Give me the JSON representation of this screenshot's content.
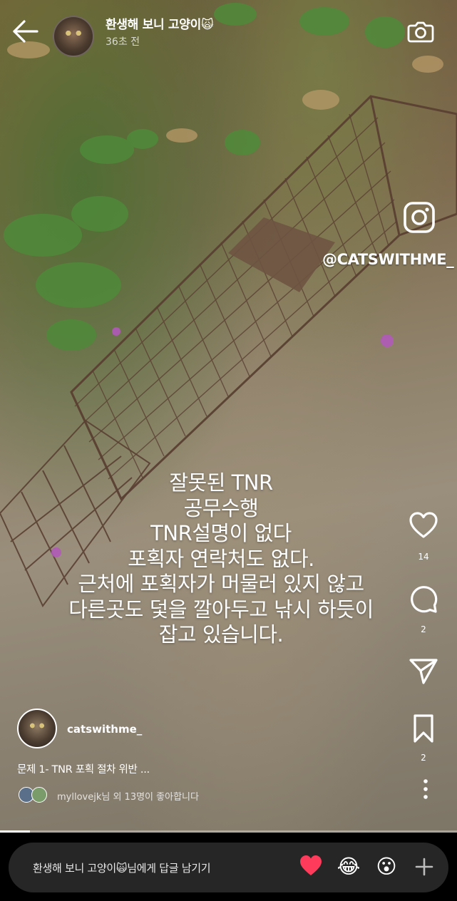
{
  "story": {
    "username": "환생해 보니 고양이🙀",
    "time": "36초 전"
  },
  "media": {
    "sticker_handle": "@CATSWITHME_",
    "overlay_lines": [
      "잘못된 TNR",
      "공무수행",
      "TNR설명이 없다",
      "포획자 연락처도 없다.",
      "근처에 포획자가 머물러 있지 않고",
      "다른곳도 덫을 깔아두고 낚시 하듯이",
      "잡고 있습니다."
    ]
  },
  "actions": {
    "like_count": "14",
    "comment_count": "2",
    "save_count": "2"
  },
  "post": {
    "author": "catswithme_",
    "caption": "문제 1- TNR 포획 절차 위반 ...",
    "likes_text": "myllovejk님 외 13명이 좋아합니다"
  },
  "progress": {
    "fraction": 0.065
  },
  "reply": {
    "placeholder": "환생해 보니 고양이🙀님에게 답글 남기기",
    "quick_reactions": [
      "❤️",
      "😂",
      "😮"
    ]
  },
  "colors": {
    "heart": "#ff3b5c",
    "reply_bg": "#262626"
  }
}
